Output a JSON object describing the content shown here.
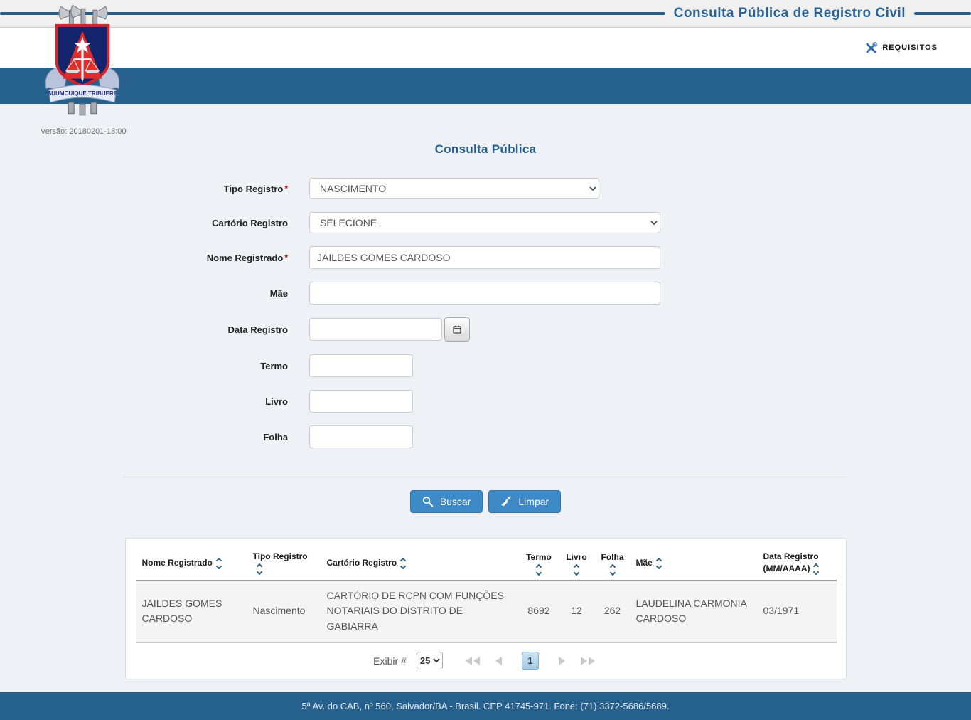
{
  "header": {
    "title": "Consulta Pública de Registro Civil",
    "requisitos_label": "REQUISITOS",
    "version": "Versão: 20180201-18:00",
    "logo_motto": "SUUMCUIQUE TRIBUERE"
  },
  "colors": {
    "band_blue": "#26618e",
    "accent_blue": "#235e8e",
    "button_blue": "#3e8ac7"
  },
  "form": {
    "title": "Consulta Pública",
    "required_marker": "*",
    "fields": {
      "tipo_registro": {
        "label": "Tipo Registro",
        "value": "NASCIMENTO"
      },
      "cartorio_registro": {
        "label": "Cartório Registro",
        "value": "SELECIONE"
      },
      "nome_registrado": {
        "label": "Nome Registrado",
        "value": "JAILDES GOMES CARDOSO"
      },
      "mae": {
        "label": "Mãe",
        "value": ""
      },
      "data_registro": {
        "label": "Data Registro",
        "value": ""
      },
      "termo": {
        "label": "Termo",
        "value": ""
      },
      "livro": {
        "label": "Livro",
        "value": ""
      },
      "folha": {
        "label": "Folha",
        "value": ""
      }
    },
    "buttons": {
      "buscar": "Buscar",
      "limpar": "Limpar"
    }
  },
  "table": {
    "columns": [
      "Nome Registrado",
      "Tipo Registro",
      "Cartório Registro",
      "Termo",
      "Livro",
      "Folha",
      "Mãe",
      "Data Registro (MM/AAAA)"
    ],
    "rows": [
      {
        "nome": "JAILDES GOMES CARDOSO",
        "tipo": "Nascimento",
        "cartorio": "CARTÓRIO DE RCPN COM FUNÇÕES NOTARIAIS DO DISTRITO DE GABIARRA",
        "termo": "8692",
        "livro": "12",
        "folha": "262",
        "mae": "LAUDELINA CARMONIA CARDOSO",
        "data": "03/1971"
      }
    ],
    "pagination": {
      "exibir_label": "Exibir #",
      "page_size": "25",
      "current_page": "1"
    }
  },
  "footer": {
    "address": "5ª Av. do CAB, nº 560, Salvador/BA - Brasil. CEP 41745-971. Fone: (71) 3372-5686/5689."
  }
}
